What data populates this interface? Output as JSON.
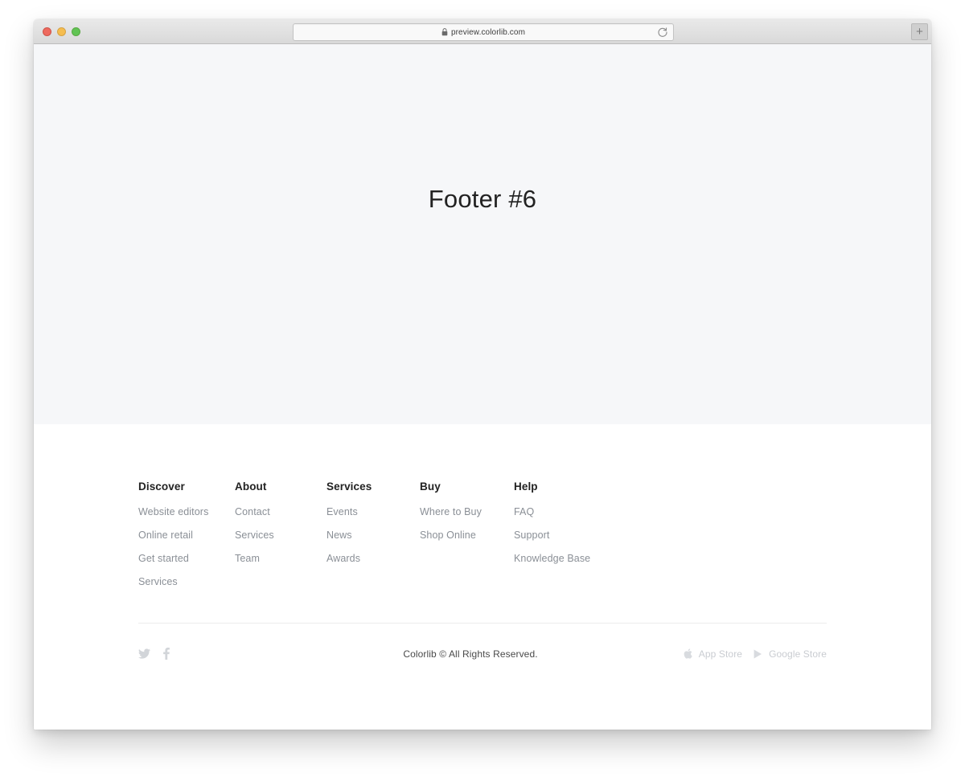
{
  "browser": {
    "traffic_lights": [
      "close",
      "minimize",
      "maximize"
    ],
    "url": "preview.colorlib.com",
    "lock_icon": "lock-icon",
    "reload_icon": "reload-icon",
    "new_tab_label": "+"
  },
  "hero": {
    "title": "Footer #6"
  },
  "footer": {
    "columns": [
      {
        "title": "Discover",
        "links": [
          "Website editors",
          "Online retail",
          "Get started",
          "Services"
        ]
      },
      {
        "title": "About",
        "links": [
          "Contact",
          "Services",
          "Team"
        ]
      },
      {
        "title": "Services",
        "links": [
          "Events",
          "News",
          "Awards"
        ]
      },
      {
        "title": "Buy",
        "links": [
          "Where to Buy",
          "Shop Online"
        ]
      },
      {
        "title": "Help",
        "links": [
          "FAQ",
          "Support",
          "Knowledge Base"
        ]
      }
    ],
    "social": [
      {
        "name": "twitter-icon",
        "label": "Twitter"
      },
      {
        "name": "facebook-icon",
        "label": "Facebook"
      }
    ],
    "copyright": "Colorlib © All Rights Reserved.",
    "stores": [
      {
        "icon": "apple-icon",
        "label": "App Store"
      },
      {
        "icon": "google-play-icon",
        "label": "Google Store"
      }
    ]
  },
  "colors": {
    "hero_background": "#f6f7f9",
    "page_background": "#ffffff",
    "heading": "#222222",
    "link": "#8a8f96",
    "muted": "#c9ccd1",
    "divider": "#ececec"
  }
}
